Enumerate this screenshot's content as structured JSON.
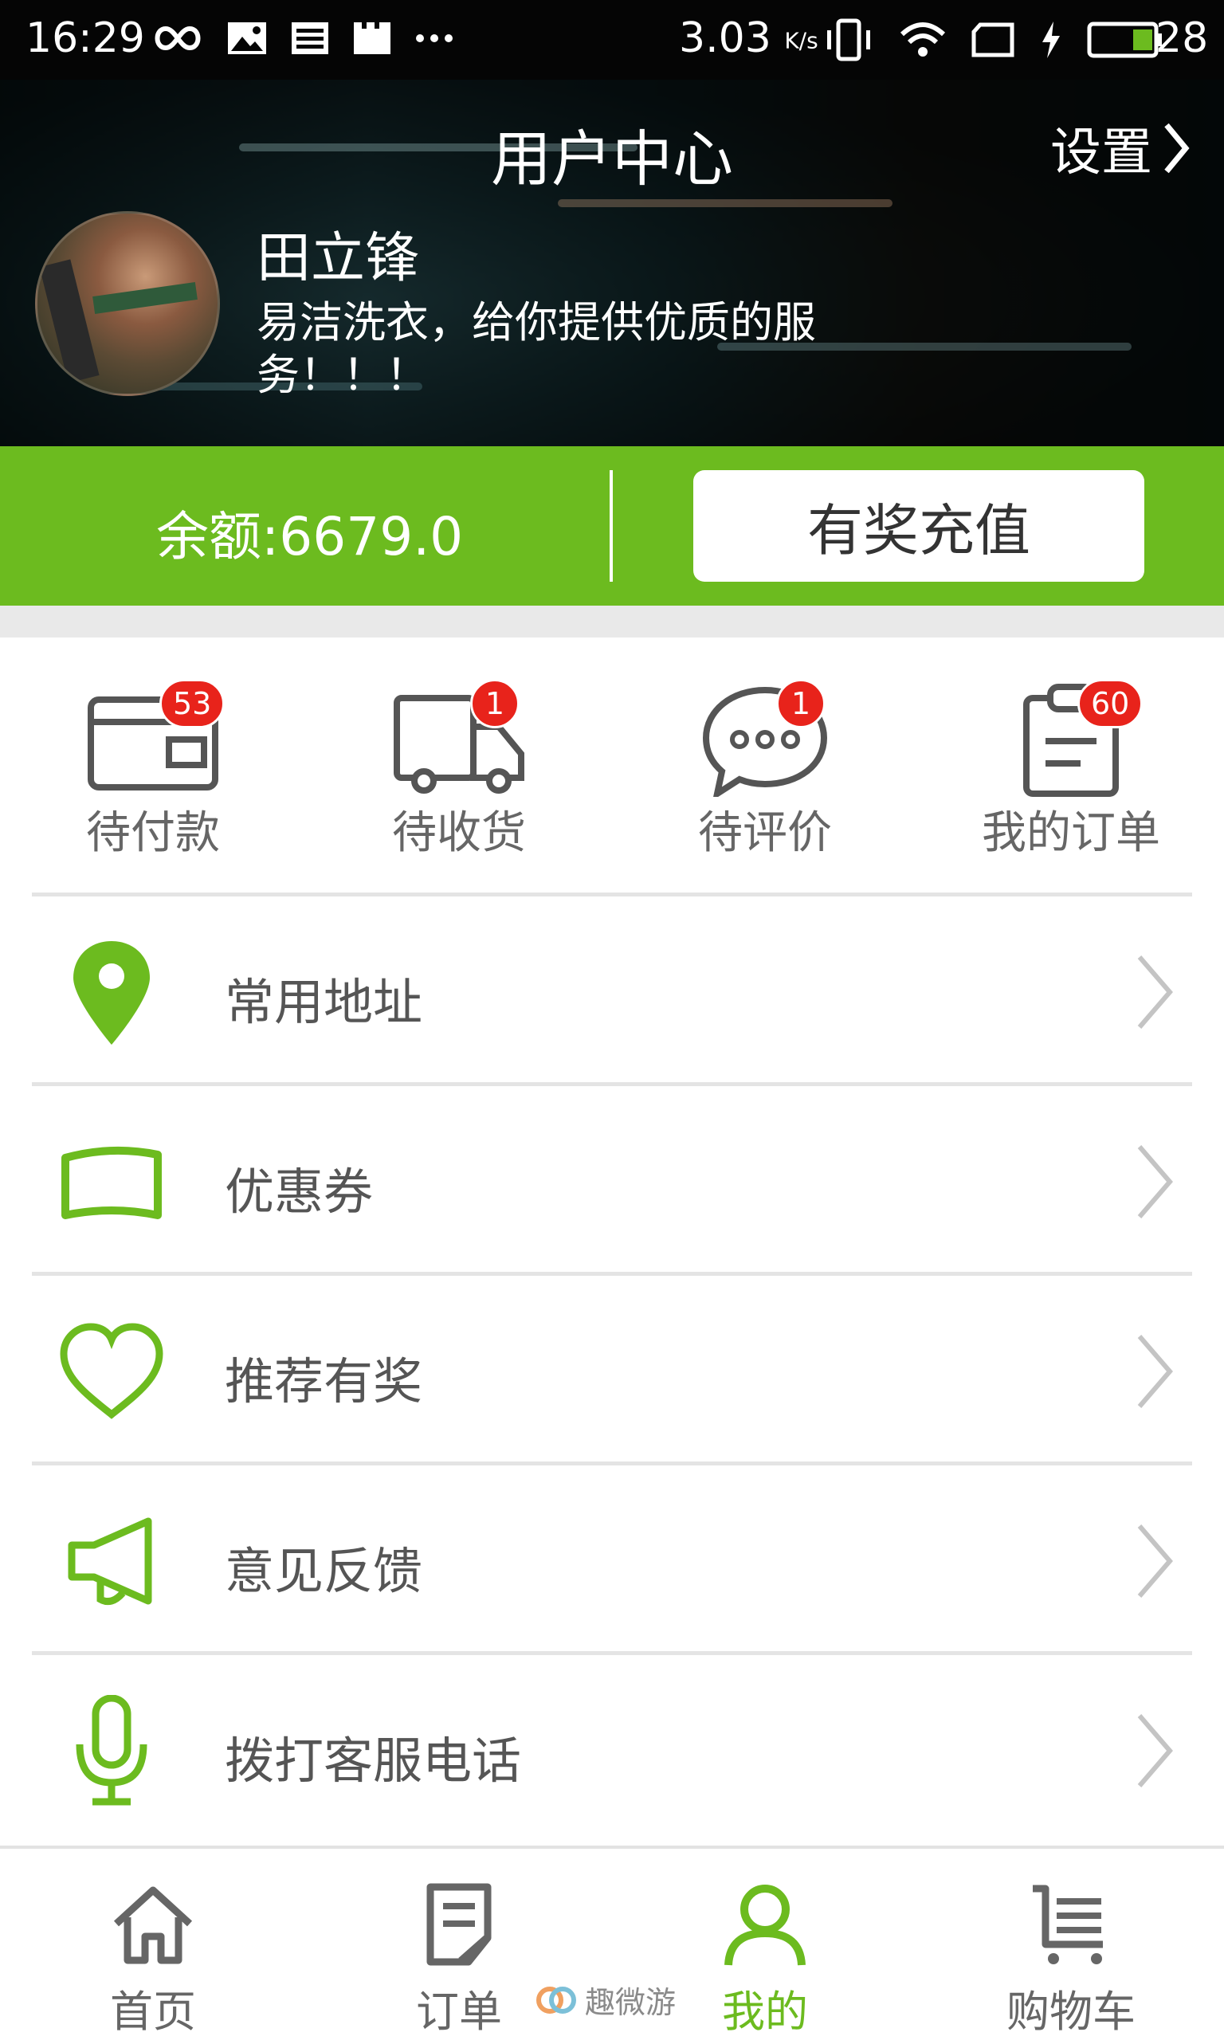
{
  "status_bar": {
    "time": "16:29",
    "speed": "3.03",
    "speed_unit": "K/s",
    "battery": "28"
  },
  "header": {
    "title": "用户中心",
    "settings_label": "设置",
    "user_name": "田立锋",
    "motto": "易洁洗衣，给你提供优质的服务！！！"
  },
  "balance": {
    "text": "余额:6679.0",
    "recharge_label": "有奖充值"
  },
  "orders": [
    {
      "label": "待付款",
      "badge": "53",
      "icon": "wallet-icon"
    },
    {
      "label": "待收货",
      "badge": "1",
      "icon": "truck-icon"
    },
    {
      "label": "待评价",
      "badge": "1",
      "icon": "chat-bubble-icon"
    },
    {
      "label": "我的订单",
      "badge": "60",
      "icon": "clipboard-icon"
    }
  ],
  "menu": [
    {
      "label": "常用地址",
      "icon": "location-pin-icon"
    },
    {
      "label": "优惠券",
      "icon": "coupon-icon"
    },
    {
      "label": "推荐有奖",
      "icon": "heart-icon"
    },
    {
      "label": "意见反馈",
      "icon": "megaphone-icon"
    },
    {
      "label": "拨打客服电话",
      "icon": "microphone-icon"
    }
  ],
  "tabs": [
    {
      "label": "首页",
      "icon": "home-icon",
      "active": false
    },
    {
      "label": "订单",
      "icon": "order-doc-icon",
      "active": false
    },
    {
      "label": "我的",
      "icon": "user-icon",
      "active": true
    },
    {
      "label": "购物车",
      "icon": "cart-icon",
      "active": false
    }
  ],
  "watermark": "趣微游",
  "colors": {
    "accent": "#6cbb1f",
    "badge": "#e8231b",
    "text_gray": "#666666"
  }
}
